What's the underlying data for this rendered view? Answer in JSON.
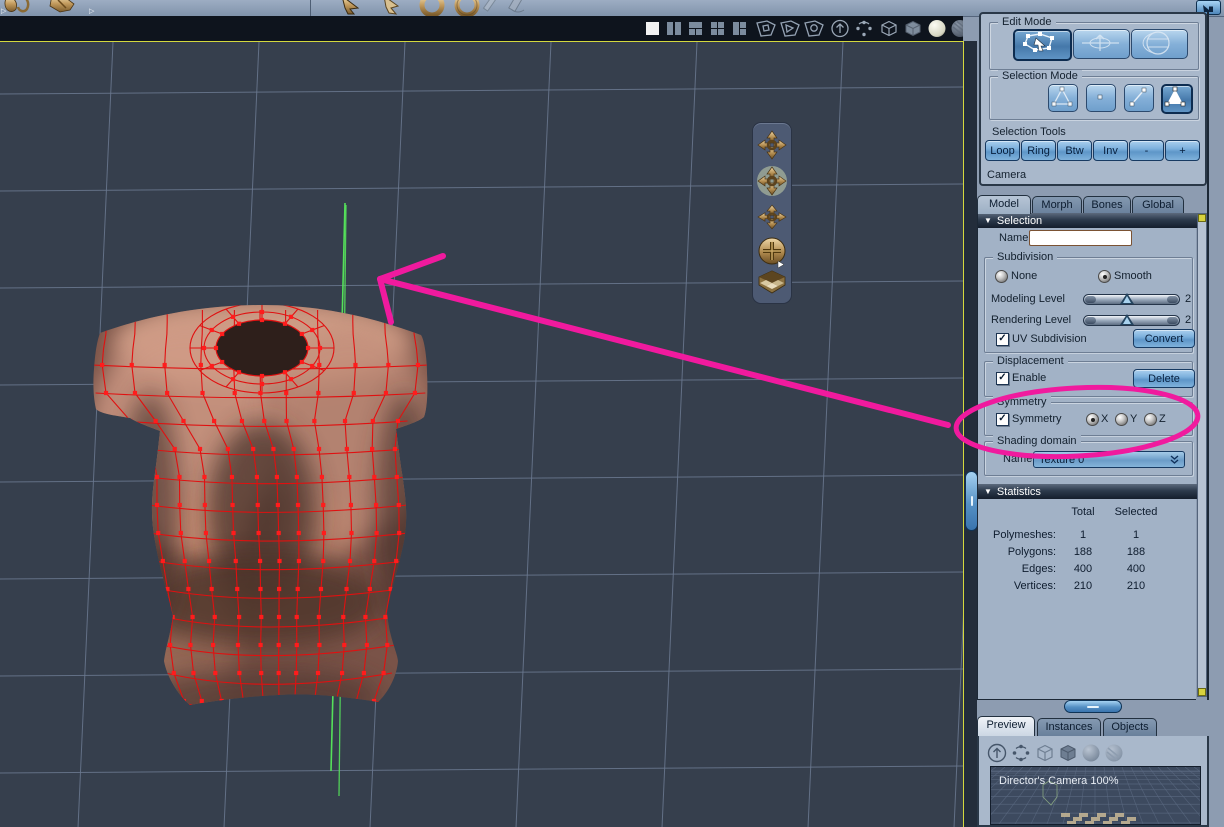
{
  "window": {
    "collapse_button_icon": "corner-arrow-icon"
  },
  "toolbar": {
    "left_icons": [
      "rotate-tool-icon",
      "move-tool-icon"
    ],
    "right_icons": [
      "cursor-select-icon",
      "cursor-direct-icon",
      "ring-3d-icon",
      "ring-3d-alt-icon",
      "knife-tool-icon",
      "scale-tool-icon"
    ]
  },
  "viewport_header": {
    "layout_icons": [
      "layout-single",
      "layout-two-pane",
      "layout-three-pane",
      "layout-four-pane",
      "layout-custom"
    ],
    "active_layout": "layout-single",
    "camera_icons": [
      "camera-shield-1-icon",
      "camera-shield-2-icon",
      "camera-shield-3-icon"
    ],
    "display_icons": [
      "up-arrow-circle-icon",
      "orbit-rotate-icon",
      "wire-cube-icon",
      "solid-cube-icon",
      "shaded-sphere-icon",
      "textured-sphere-icon"
    ],
    "active_display": "shaded-sphere-icon"
  },
  "viewport": {
    "background": "#363f4d",
    "grid_color": "#6b7990",
    "symmetry_line_color": "#55e05a",
    "mesh_wire_color": "#e01010"
  },
  "annotation": {
    "color": "#f01a9e"
  },
  "nav_palette": {
    "tools": [
      "camera-pan",
      "camera-orbit",
      "camera-track",
      "camera-dolly",
      "camera-reference-cube"
    ]
  },
  "right_panel": {
    "tool_panel": {
      "edit_mode": {
        "label": "Edit Mode",
        "buttons": [
          {
            "name": "vertex-modeling-mode",
            "selected": true
          },
          {
            "name": "animation-mode",
            "selected": false
          },
          {
            "name": "uv-mapping-mode",
            "selected": false
          }
        ]
      },
      "selection_mode": {
        "label": "Selection Mode",
        "buttons": [
          {
            "name": "polygon-outline-select",
            "selected": false
          },
          {
            "name": "vertex-select",
            "selected": false
          },
          {
            "name": "edge-select",
            "selected": false
          },
          {
            "name": "polygon-select",
            "selected": true
          }
        ]
      },
      "selection_tools": {
        "label": "Selection Tools",
        "buttons": [
          "Loop",
          "Ring",
          "Btw",
          "Inv",
          "-",
          "+"
        ]
      },
      "camera_label": "Camera"
    },
    "tabs": {
      "items": [
        "Model",
        "Morph",
        "Bones",
        "Global"
      ],
      "selected": "Model"
    },
    "selection": {
      "header": "Selection",
      "name_label": "Name",
      "name_value": "",
      "subdivision": {
        "label": "Subdivision",
        "options": [
          {
            "label": "None",
            "selected": false
          },
          {
            "label": "Smooth",
            "selected": true
          }
        ],
        "modeling_level_label": "Modeling Level",
        "modeling_level_value": "2",
        "rendering_level_label": "Rendering Level",
        "rendering_level_value": "2",
        "uv_subdivision_label": "UV Subdivision",
        "uv_subdivision_checked": true,
        "convert_label": "Convert"
      },
      "displacement": {
        "label": "Displacement",
        "enable_label": "Enable",
        "enable_checked": true,
        "delete_label": "Delete"
      },
      "symmetry": {
        "label": "Symmetry",
        "checkbox_label": "Symmetry",
        "checked": true,
        "axes": [
          {
            "label": "X",
            "selected": true
          },
          {
            "label": "Y",
            "selected": false
          },
          {
            "label": "Z",
            "selected": false
          }
        ]
      },
      "shading_domain": {
        "label": "Shading domain",
        "name_label": "Name",
        "value": "Texture 0"
      }
    },
    "statistics": {
      "header": "Statistics",
      "columns": [
        "Total",
        "Selected"
      ],
      "rows": [
        {
          "label": "Polymeshes:",
          "total": "1",
          "selected": "1"
        },
        {
          "label": "Polygons:",
          "total": "188",
          "selected": "188"
        },
        {
          "label": "Edges:",
          "total": "400",
          "selected": "400"
        },
        {
          "label": "Vertices:",
          "total": "210",
          "selected": "210"
        }
      ]
    },
    "bottom_tabs": {
      "items": [
        "Preview",
        "Instances",
        "Objects"
      ],
      "selected": "Preview"
    },
    "preview": {
      "camera_label": "Director's Camera 100%",
      "icons": [
        "up-arrow-circle-icon",
        "orbit-rotate-icon",
        "wire-cube-icon",
        "solid-cube-icon",
        "shaded-sphere-icon",
        "textured-sphere-icon"
      ]
    }
  }
}
